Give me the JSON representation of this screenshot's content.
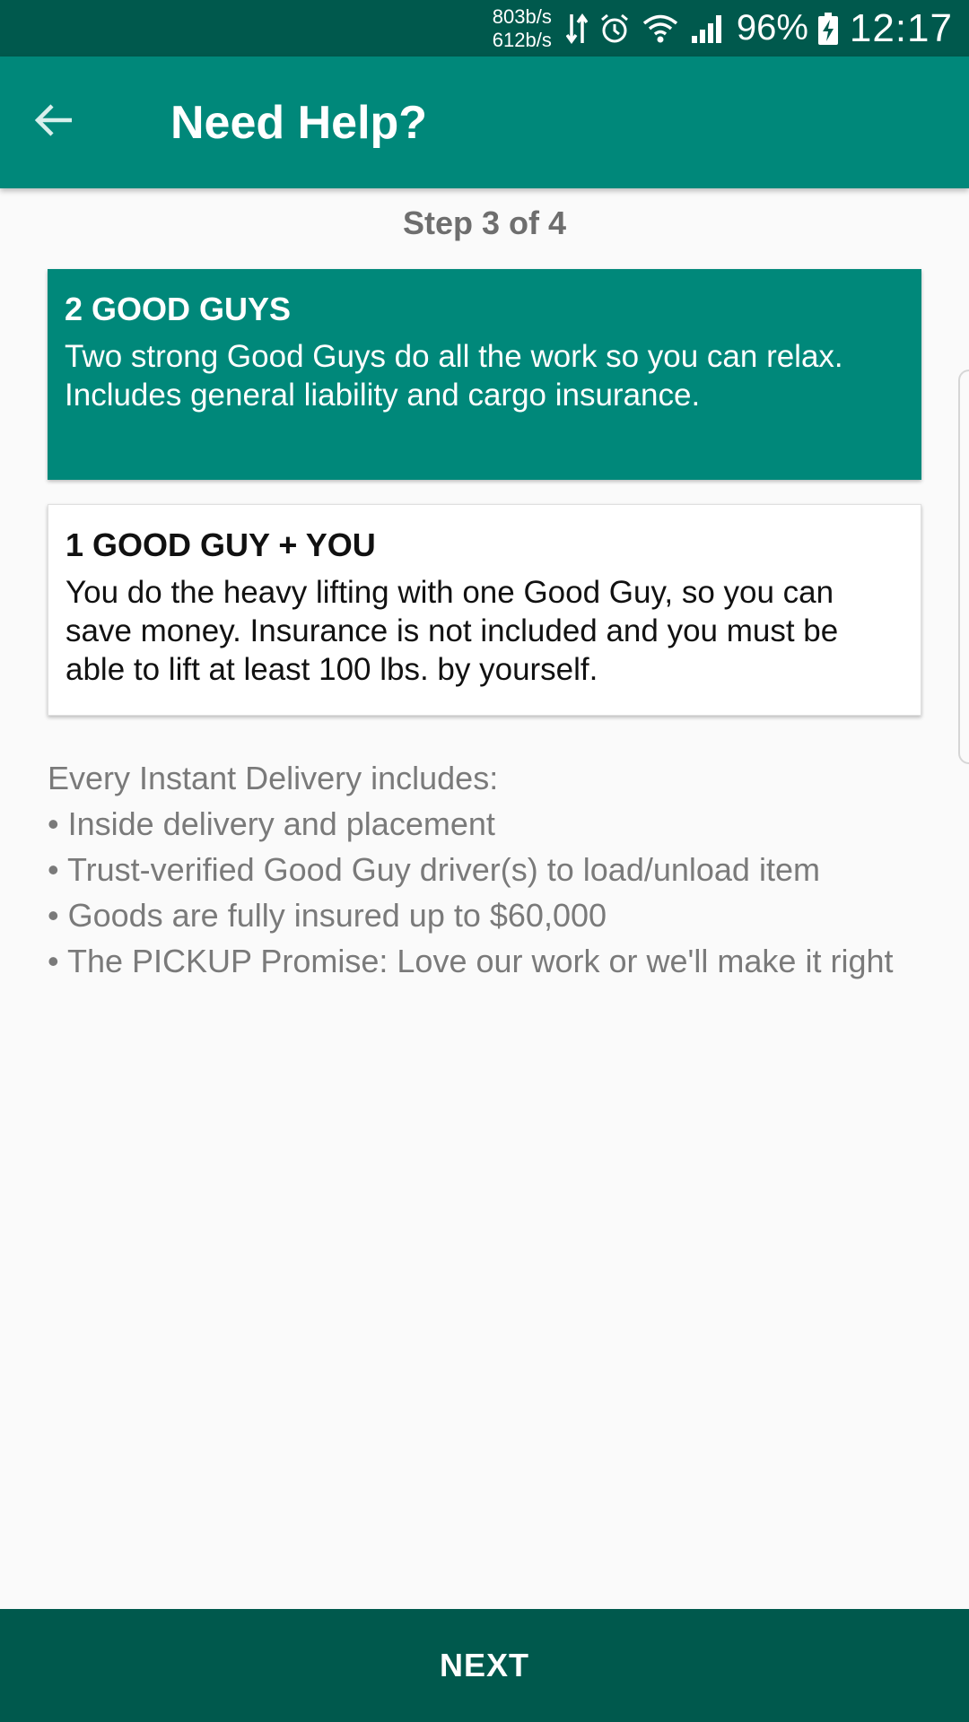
{
  "status_bar": {
    "net_down": "803b/s",
    "net_up": "612b/s",
    "battery": "96%",
    "time": "12:17",
    "icons": [
      "data-transfer-icon",
      "alarm-icon",
      "wifi-icon",
      "signal-icon",
      "battery-charging-icon"
    ]
  },
  "app_bar": {
    "title": "Need Help?",
    "back_icon": "arrow-back-icon"
  },
  "step": "Step 3 of 4",
  "options": [
    {
      "title": "2 GOOD GUYS",
      "description": "Two strong Good Guys do all the work so you can relax. Includes general liability and cargo insurance.",
      "selected": true
    },
    {
      "title": "1 GOOD GUY + YOU",
      "description": "You do the heavy lifting with one Good Guy, so you can save money. Insurance is not included and you must be able to lift at least 100 lbs. by yourself.",
      "selected": false
    }
  ],
  "includes": {
    "heading": "Every Instant Delivery includes:",
    "items": [
      "• Inside delivery and placement",
      "• Trust-verified Good Guy driver(s) to load/unload item",
      "• Goods are fully insured up to $60,000",
      "• The PICKUP Promise: Love our work or we'll make it right"
    ]
  },
  "next_label": "NEXT",
  "colors": {
    "primary": "#00887a",
    "primary_dark": "#00594d",
    "background": "#fafafa"
  }
}
